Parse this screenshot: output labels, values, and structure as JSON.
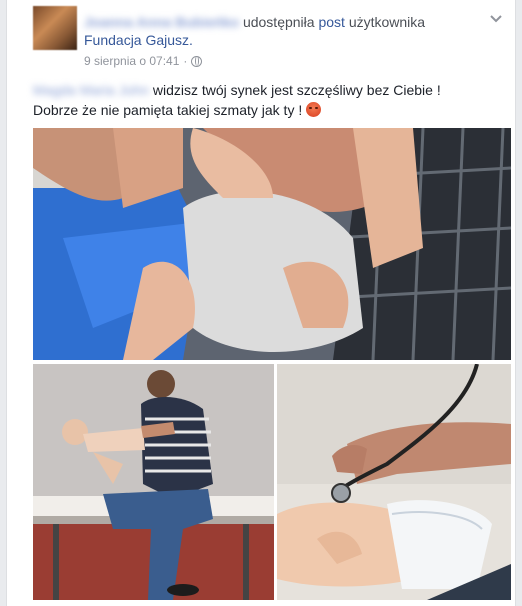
{
  "post": {
    "sharer_name": "Joanna Anna Bubieńko",
    "shared_text": "udostępniła",
    "post_link": "post",
    "user_text": "użytkownika",
    "page_name": "Fundacja Gajusz.",
    "timestamp": "9 sierpnia o 07:41",
    "separator": "·",
    "menu_icon": "chevron-down-icon",
    "privacy_icon": "globe-icon",
    "mention_name": "Magda Maria John",
    "body_line1": " widzisz twój synek jest szczęśliwy bez Ciebie !",
    "body_line2": "Dobrze że nie pamięta takiej szmaty jak ty ! ",
    "emoji": "angry-face-emoji"
  },
  "photos": [
    {
      "name": "photo-baby-held-by-adult"
    },
    {
      "name": "photo-man-demonstrating-infant-first-aid"
    },
    {
      "name": "photo-stethoscope-on-infant-doll"
    }
  ]
}
